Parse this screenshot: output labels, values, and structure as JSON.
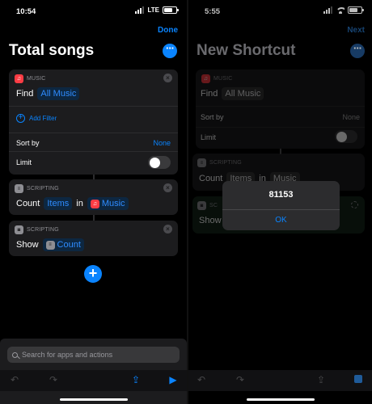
{
  "left": {
    "status": {
      "time": "10:54",
      "network": "LTE"
    },
    "nav": {
      "done": "Done"
    },
    "title": "Total songs",
    "music_action": {
      "category": "MUSIC",
      "find_label": "Find",
      "find_value": "All Music",
      "add_filter": "Add Filter",
      "sort_by_label": "Sort by",
      "sort_by_value": "None",
      "limit_label": "Limit",
      "limit_on": false
    },
    "count_action": {
      "category": "SCRIPTING",
      "label": "Count",
      "items": "Items",
      "in": "in",
      "source": "Music"
    },
    "show_action": {
      "category": "SCRIPTING",
      "label": "Show",
      "value": "Count"
    },
    "search": {
      "placeholder": "Search for apps and actions"
    }
  },
  "right": {
    "status": {
      "time": "5:55"
    },
    "nav": {
      "next": "Next"
    },
    "title": "New Shortcut",
    "music_action": {
      "category": "MUSIC",
      "find_label": "Find",
      "find_value": "All Music",
      "sort_by_label": "Sort by",
      "sort_by_value": "None",
      "limit_label": "Limit"
    },
    "count_action": {
      "category": "SCRIPTING",
      "label": "Count",
      "items": "Items",
      "in": "in",
      "source": "Music"
    },
    "show_action": {
      "category": "SC",
      "label": "Show"
    },
    "alert": {
      "message": "81153",
      "ok": "OK"
    }
  },
  "icons": {
    "music": "music-note-icon",
    "scripting": "scripting-icon",
    "close": "close-icon",
    "more": "ellipsis-icon",
    "add": "plus-icon",
    "search": "search-icon",
    "undo": "undo-icon",
    "redo": "redo-icon",
    "share": "share-icon",
    "play": "play-icon",
    "stop": "stop-icon"
  },
  "colors": {
    "accent": "#0a84ff",
    "music": "#fc3c44",
    "card": "#1c1c1e"
  }
}
